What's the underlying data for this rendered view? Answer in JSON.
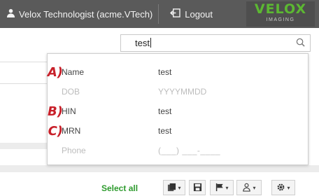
{
  "header": {
    "user_label": "Velox Technologist (acme.VTech)",
    "logout_label": "Logout",
    "logo_brand": "VELOX",
    "logo_sub": "IMAGING"
  },
  "search": {
    "value": "test"
  },
  "popup": {
    "rows": [
      {
        "letter": "A)",
        "label": "Name",
        "value": "test",
        "state": "active"
      },
      {
        "letter": "",
        "label": "DOB",
        "value": "YYYYMMDD",
        "state": "muted"
      },
      {
        "letter": "B)",
        "label": "HIN",
        "value": "test",
        "state": "active"
      },
      {
        "letter": "C)",
        "label": "MRN",
        "value": "test",
        "state": "active"
      },
      {
        "letter": "",
        "label": "Phone",
        "value": "(___) ___-____",
        "state": "muted"
      }
    ]
  },
  "toolbar": {
    "select_all": "Select all",
    "dropdown_caret": "▾",
    "buttons": [
      "document-icon",
      "save-icon",
      "flag-icon",
      "user-group-icon",
      "gear-icon"
    ]
  },
  "colors": {
    "header_bg": "#5a5a5a",
    "brand_green": "#5cb832",
    "annotation_red": "#c8202a",
    "select_all_green": "#2e9b2e"
  }
}
